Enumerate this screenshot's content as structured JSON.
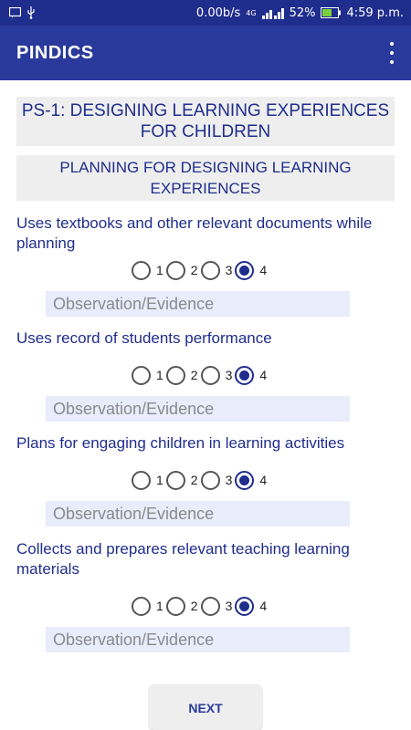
{
  "status_bar": {
    "network_speed": "0.00b/s",
    "network_type": "4G",
    "battery": "52%",
    "time": "4:59 p.m."
  },
  "app_bar": {
    "title": "PINDICS"
  },
  "section": {
    "title": "PS-1: DESIGNING LEARNING EXPERIENCES FOR CHILDREN",
    "subtitle": "PLANNING FOR DESIGNING LEARNING EXPERIENCES"
  },
  "questions": [
    {
      "text": "Uses textbooks and other relevant documents while planning",
      "options": [
        "1",
        "2",
        "3",
        "4"
      ],
      "selected": "4",
      "placeholder": "Observation/Evidence"
    },
    {
      "text": "Uses record of students performance",
      "options": [
        "1",
        "2",
        "3",
        "4"
      ],
      "selected": "4",
      "placeholder": "Observation/Evidence"
    },
    {
      "text": "Plans for engaging children in learning activities",
      "options": [
        "1",
        "2",
        "3",
        "4"
      ],
      "selected": "4",
      "placeholder": "Observation/Evidence"
    },
    {
      "text": "Collects and prepares relevant teaching learning materials",
      "options": [
        "1",
        "2",
        "3",
        "4"
      ],
      "selected": "4",
      "placeholder": "Observation/Evidence"
    }
  ],
  "next_button": "NEXT",
  "colors": {
    "primary": "#2a3a9c",
    "status_bar": "#1f2d8c",
    "header_bg": "#eeeeee",
    "input_bg": "#e8ecfb"
  }
}
